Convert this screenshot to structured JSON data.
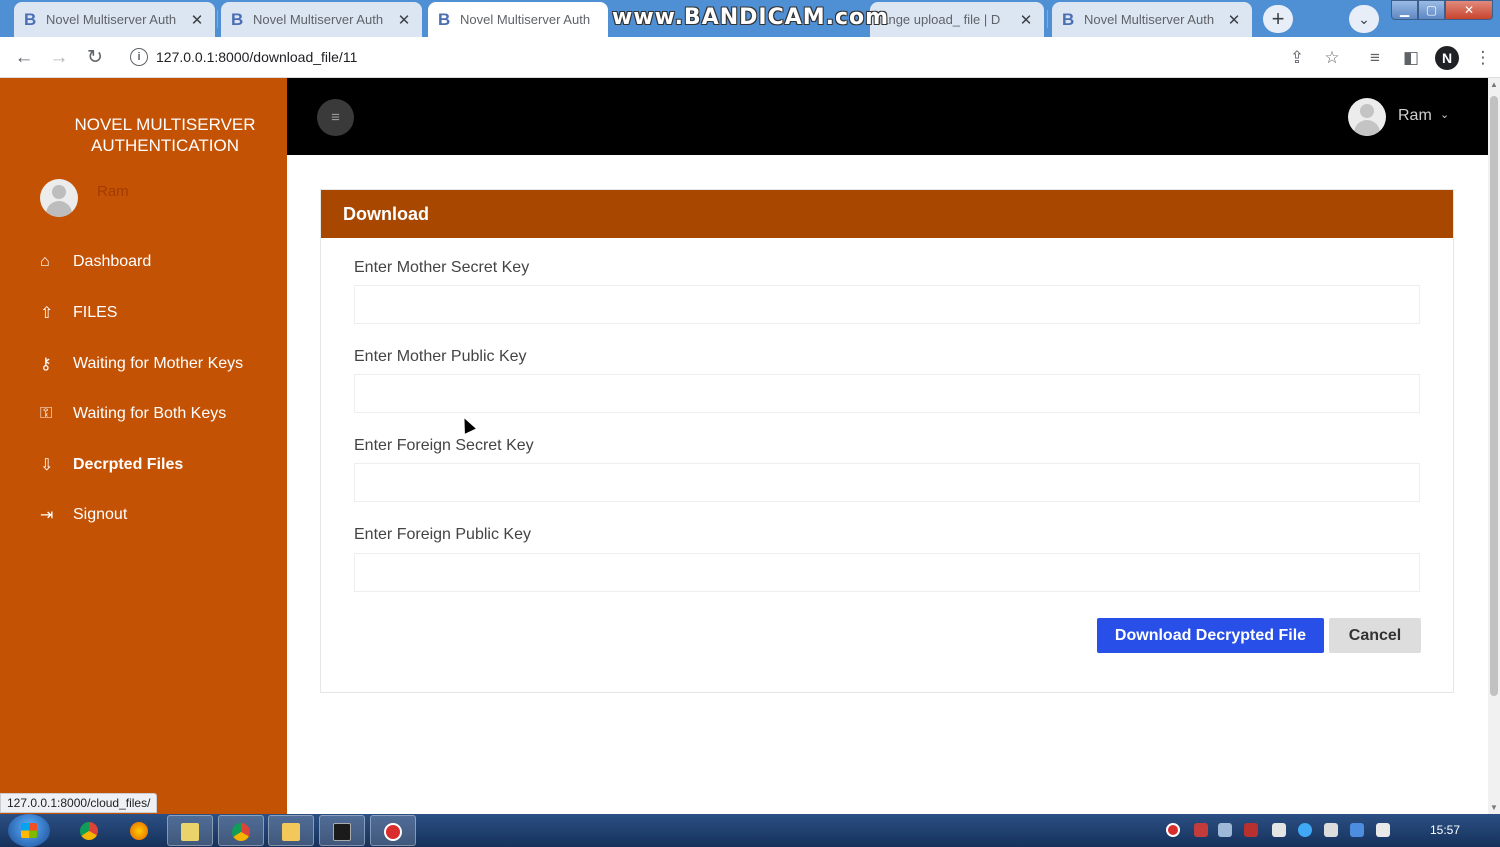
{
  "browser": {
    "tabs": [
      {
        "title": "Novel Multiserver Auth",
        "favicon": "B"
      },
      {
        "title": "Novel Multiserver Auth",
        "favicon": "B"
      },
      {
        "title": "Novel Multiserver Auth",
        "favicon": "B"
      },
      {
        "title": "hange upload_ file | D",
        "favicon": ""
      },
      {
        "title": "Novel Multiserver Auth",
        "favicon": "B"
      }
    ],
    "watermark": "www.BANDICAM.com",
    "url": "127.0.0.1:8000/download_file/11",
    "status_url": "127.0.0.1:8000/cloud_files/"
  },
  "sidebar": {
    "brand": "NOVEL MULTISERVER AUTHENTICATION",
    "username": "Ram",
    "items": [
      {
        "label": "Dashboard",
        "icon": "home-icon"
      },
      {
        "label": "FILES",
        "icon": "upload-icon"
      },
      {
        "label": "Waiting for Mother Keys",
        "icon": "key-icon"
      },
      {
        "label": "Waiting for Both Keys",
        "icon": "keys-icon"
      },
      {
        "label": "Decrpted Files",
        "icon": "download-icon"
      },
      {
        "label": "Signout",
        "icon": "signout-icon"
      }
    ]
  },
  "topbar": {
    "username": "Ram"
  },
  "form": {
    "header": "Download",
    "fields": [
      {
        "label": "Enter Mother Secret Key",
        "value": ""
      },
      {
        "label": "Enter Mother Public Key",
        "value": ""
      },
      {
        "label": "Enter Foreign Secret Key",
        "value": ""
      },
      {
        "label": "Enter Foreign Public Key",
        "value": ""
      }
    ],
    "submit_label": "Download Decrypted File",
    "cancel_label": "Cancel"
  },
  "taskbar": {
    "clock": "15:57"
  },
  "colors": {
    "sidebar": "#c45204",
    "card_header": "#a84800",
    "primary_button": "#2850e8",
    "topbar": "#000000"
  }
}
